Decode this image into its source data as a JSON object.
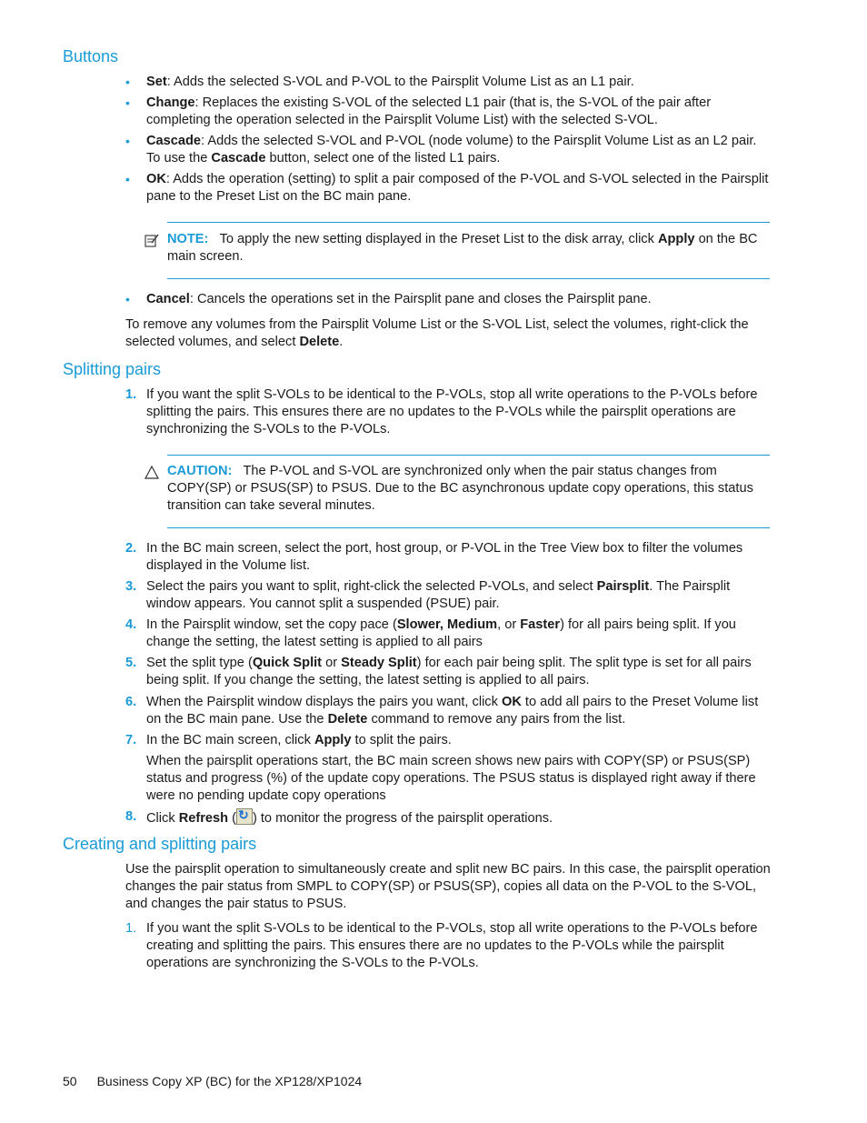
{
  "sections": {
    "buttons": {
      "heading": "Buttons",
      "items": [
        {
          "term": "Set",
          "text": ": Adds the selected S-VOL and P-VOL to the Pairsplit Volume List as an L1 pair."
        },
        {
          "term": "Change",
          "text": ": Replaces the existing S-VOL of the selected L1 pair (that is, the S-VOL of the pair after completing the operation selected in the Pairsplit Volume List) with the selected S-VOL."
        },
        {
          "term": "Cascade",
          "text": ": Adds the selected S-VOL and P-VOL (node volume) to the Pairsplit Volume List as an L2 pair. To use the ",
          "term2": "Cascade",
          "text2": " button, select one of the listed L1 pairs."
        },
        {
          "term": "OK",
          "text": ": Adds the operation (setting) to split a pair composed of the P-VOL and S-VOL selected in the Pairsplit pane to the Preset List on the BC main pane."
        },
        {
          "term": "Cancel",
          "text": ": Cancels the operations set in the Pairsplit pane and closes the Pairsplit pane."
        }
      ],
      "note": {
        "label": "NOTE:",
        "text": "To apply the new setting displayed in the Preset List to the disk array, click ",
        "bold": "Apply",
        "text2": " on the BC main screen."
      },
      "remove_para": {
        "text": "To remove any volumes from the Pairsplit Volume List or the S-VOL List, select the volumes, right-click the selected volumes, and select ",
        "bold": "Delete",
        "end": "."
      }
    },
    "splitting": {
      "heading": "Splitting pairs",
      "step1": {
        "num": "1.",
        "text": "If you want the split S-VOLs to be identical to the P-VOLs, stop all write operations to the P-VOLs before splitting the pairs. This ensures there are no updates to the P-VOLs while the pairsplit operations are synchronizing the S-VOLs to the P-VOLs."
      },
      "caution": {
        "label": "CAUTION:",
        "text": "The P-VOL and S-VOL are synchronized only when the pair status changes from COPY(SP) or PSUS(SP) to PSUS. Due to the BC asynchronous update copy operations, this status transition can take several minutes."
      },
      "step2": {
        "num": "2.",
        "text": "In the BC main screen, select the port, host group, or P-VOL in the Tree View box to filter the volumes displayed in the Volume list."
      },
      "step3": {
        "num": "3.",
        "a": "Select the pairs you want to split, right-click the selected P-VOLs, and select ",
        "b": "Pairsplit",
        "c": ". The Pairsplit window appears. You cannot split a suspended (PSUE) pair."
      },
      "step4": {
        "num": "4.",
        "a": "In the Pairsplit window, set the copy pace (",
        "b": "Slower, Medium",
        "c": ", or ",
        "d": "Faster",
        "e": ") for all pairs being split. If you change the setting, the latest setting is applied to all pairs"
      },
      "step5": {
        "num": "5.",
        "a": "Set the split type (",
        "b": "Quick Split",
        "c": " or ",
        "d": "Steady Split",
        "e": ") for each pair being split. The split type is set for all pairs being split. If you change the setting, the latest setting is applied to all pairs."
      },
      "step6": {
        "num": "6.",
        "a": "When the Pairsplit window displays the pairs you want, click ",
        "b": "OK",
        "c": " to add all pairs to the Preset Volume list on the BC main pane. Use the ",
        "d": "Delete",
        "e": " command to remove any pairs from the list."
      },
      "step7": {
        "num": "7.",
        "a": "In the BC main screen, click ",
        "b": "Apply",
        "c": " to split the pairs."
      },
      "step7_detail": "When the pairsplit operations start, the BC main screen shows new pairs with COPY(SP) or PSUS(SP) status and progress (%) of the update copy operations. The PSUS status is displayed right away if there were no pending update copy operations",
      "step8": {
        "num": "8.",
        "a": "Click ",
        "b": "Refresh",
        "c": " (",
        "d": ") to monitor the progress of the pairsplit operations."
      }
    },
    "creating": {
      "heading": "Creating and splitting pairs",
      "intro": "Use the pairsplit operation to simultaneously create and split new BC pairs. In this case, the pairsplit operation changes the pair status from SMPL to COPY(SP) or PSUS(SP), copies all data on the P-VOL to the S-VOL, and changes the pair status to PSUS.",
      "step1": {
        "num": "1.",
        "text": "If you want the split S-VOLs to be identical to the P-VOLs, stop all write operations to the P-VOLs before creating and splitting the pairs. This ensures there are no updates to the P-VOLs while the pairsplit operations are synchronizing the S-VOLs to the P-VOLs."
      }
    }
  },
  "footer": {
    "page": "50",
    "title": "Business Copy XP (BC) for the XP128/XP1024"
  }
}
